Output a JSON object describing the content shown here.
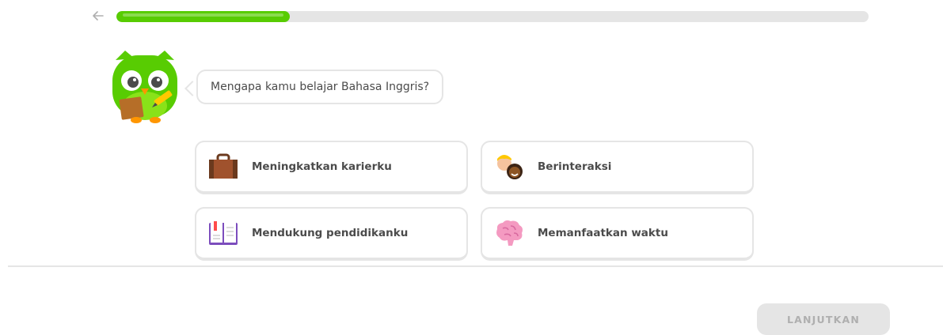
{
  "header": {
    "back_icon": "arrow-left-icon",
    "progress_fraction": 0.23,
    "colors": {
      "progress_fill": "#58cc02",
      "progress_track": "#e5e5e5"
    }
  },
  "mascot": {
    "icon": "duo-owl-with-notebook-icon"
  },
  "question": {
    "text": "Mengapa kamu belajar Bahasa Inggris?"
  },
  "options": [
    {
      "label": "Meningkatkan karierku",
      "icon": "briefcase-icon"
    },
    {
      "label": "Berinteraksi",
      "icon": "two-people-icon"
    },
    {
      "label": "Mendukung pendidikanku",
      "icon": "open-book-icon"
    },
    {
      "label": "Memanfaatkan waktu",
      "icon": "brain-icon"
    }
  ],
  "footer": {
    "continue_label": "LANJUTKAN",
    "continue_disabled": true
  }
}
